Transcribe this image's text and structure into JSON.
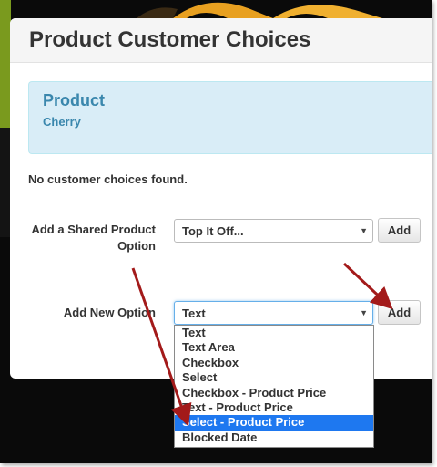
{
  "dialog": {
    "title": "Product Customer Choices"
  },
  "product_panel": {
    "title": "Product",
    "name": "Cherry"
  },
  "empty_message": "No customer choices found.",
  "shared_option": {
    "label": "Add a Shared Product Option",
    "selected": "Top It Off...",
    "add_label": "Add"
  },
  "new_option": {
    "label": "Add New Option",
    "selected": "Text",
    "add_label": "Add",
    "options": [
      "Text",
      "Text Area",
      "Checkbox",
      "Select",
      "Checkbox - Product Price",
      "Text - Product Price",
      "Select - Product Price",
      "Blocked Date"
    ],
    "highlighted_option": "Select - Product Price"
  },
  "colors": {
    "panel_bg": "#d9edf7",
    "panel_text": "#3a87ad",
    "highlight": "#1e78f0",
    "annotation_arrow": "#a31a1a"
  }
}
